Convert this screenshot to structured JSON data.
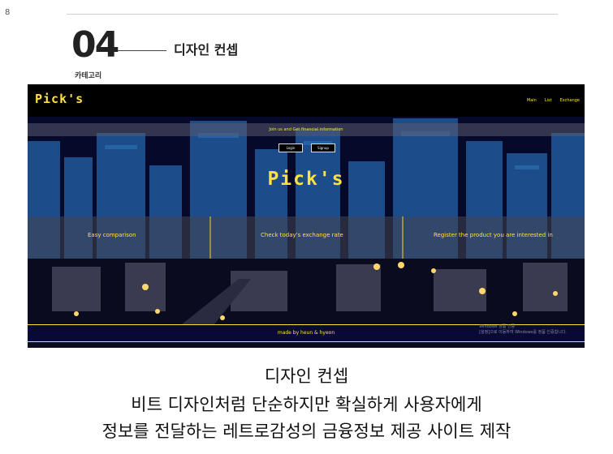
{
  "page_number": "8",
  "section": {
    "number": "04",
    "title": "디자인 컨셉",
    "category": "카테고리"
  },
  "screenshot": {
    "logo_small": "Pick's",
    "menu": [
      "Main",
      "List",
      "Exchange"
    ],
    "banner": "Join us and Get financial information",
    "buttons": [
      "Login",
      "Signup"
    ],
    "logo_big": "Pick's",
    "features": [
      "Easy comparison",
      "Check today's exchange rate",
      "Register the product you are interested in"
    ],
    "footer": "made by heun & hyeon",
    "watermark_1": "Windows 정품 인증",
    "watermark_2": "[설정]으로 이동하여 Windows를 정품 인증합니다."
  },
  "caption": {
    "line1": "디자인 컨셉",
    "line2": "비트 디자인처럼 단순하지만 확실하게 사용자에게",
    "line3": "정보를 전달하는 레트로감성의 금융정보 제공 사이트 제작"
  },
  "colors": {
    "accent": "#ffe23a",
    "bg_dark": "#05051a",
    "city_blue": "#1c4d8a"
  }
}
